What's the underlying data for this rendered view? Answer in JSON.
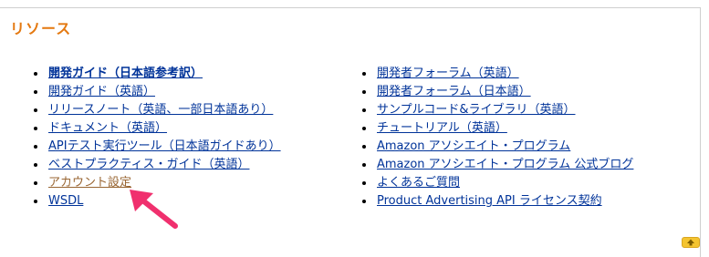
{
  "heading": "リソース",
  "left_links": [
    {
      "label": "開発ガイド（日本語参考訳）",
      "style": "bold"
    },
    {
      "label": "開発ガイド（英語）",
      "style": "normal"
    },
    {
      "label": "リリースノート（英語、一部日本語あり）",
      "style": "normal"
    },
    {
      "label": "ドキュメント（英語）",
      "style": "normal"
    },
    {
      "label": "APIテスト実行ツール（日本語ガイドあり）",
      "style": "normal"
    },
    {
      "label": "ベストプラクティス・ガイド（英語）",
      "style": "normal"
    },
    {
      "label": "アカウント設定",
      "style": "visited"
    },
    {
      "label": "WSDL",
      "style": "normal"
    }
  ],
  "right_links": [
    {
      "label": "開発者フォーラム（英語）",
      "style": "normal"
    },
    {
      "label": "開発者フォーラム（日本語）",
      "style": "normal"
    },
    {
      "label": "サンプルコード&ライブラリ（英語）",
      "style": "normal"
    },
    {
      "label": "チュートリアル（英語）",
      "style": "normal"
    },
    {
      "label": "Amazon アソシエイト・プログラム",
      "style": "normal"
    },
    {
      "label": "Amazon アソシエイト・プログラム 公式ブログ",
      "style": "normal"
    },
    {
      "label": "よくあるご質問",
      "style": "normal"
    },
    {
      "label": "Product Advertising API ライセンス契約",
      "style": "normal"
    }
  ],
  "back_to_top_icon": "arrow-up-icon",
  "annotation_arrow_color": "#f0306e",
  "colors": {
    "heading": "#e47911",
    "link": "#003399",
    "visited_link": "#996633",
    "top_button": "#f4c430"
  }
}
